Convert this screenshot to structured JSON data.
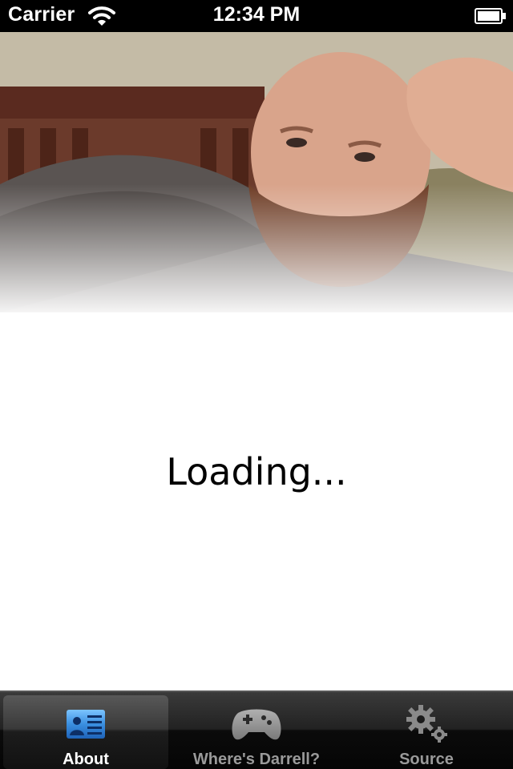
{
  "status_bar": {
    "carrier": "Carrier",
    "time": "12:34 PM"
  },
  "main": {
    "loading_text": "Loading..."
  },
  "tab_bar": {
    "tabs": [
      {
        "label": "About",
        "icon": "contact-card-icon",
        "selected": true
      },
      {
        "label": "Where's Darrell?",
        "icon": "game-controller-icon",
        "selected": false
      },
      {
        "label": "Source",
        "icon": "gears-icon",
        "selected": false
      }
    ]
  },
  "colors": {
    "selected_icon": "#3a8fe0",
    "unselected": "#9a9a9a",
    "tab_bar_bg": "#1a1a1a"
  }
}
